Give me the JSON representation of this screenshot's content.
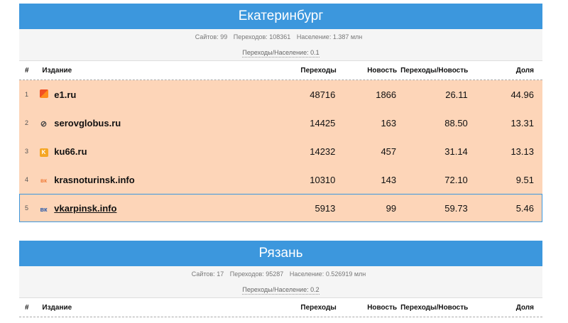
{
  "sections": [
    {
      "title": "Екатеринбург",
      "stats": {
        "sites_label": "Сайтов:",
        "sites_value": "99",
        "hits_label": "Переходов:",
        "hits_value": "108361",
        "population_label": "Население:",
        "population_value": "1.387 млн",
        "ratio_label": "Переходы/Население:",
        "ratio_value": "0.1"
      },
      "columns": {
        "num": "#",
        "name": "Издание",
        "hits": "Переходы",
        "news": "Новость",
        "ratio": "Переходы/Новость",
        "share": "Доля"
      },
      "rows": [
        {
          "num": "1",
          "icon": "e1-logo-icon",
          "name": "e1.ru",
          "hits": "48716",
          "news": "1866",
          "ratio": "26.11",
          "share": "44.96"
        },
        {
          "num": "2",
          "icon": "serovglobus-logo-icon",
          "name": "serovglobus.ru",
          "hits": "14425",
          "news": "163",
          "ratio": "88.50",
          "share": "13.31"
        },
        {
          "num": "3",
          "icon": "ku66-logo-icon",
          "name": "ku66.ru",
          "hits": "14232",
          "news": "457",
          "ratio": "31.14",
          "share": "13.13"
        },
        {
          "num": "4",
          "icon": "krasnoturinsk-logo-icon",
          "name": "krasnoturinsk.info",
          "hits": "10310",
          "news": "143",
          "ratio": "72.10",
          "share": "9.51"
        },
        {
          "num": "5",
          "icon": "vkarpinsk-logo-icon",
          "name": "vkarpinsk.info",
          "hits": "5913",
          "news": "99",
          "ratio": "59.73",
          "share": "5.46"
        }
      ]
    },
    {
      "title": "Рязань",
      "stats": {
        "sites_label": "Сайтов:",
        "sites_value": "17",
        "hits_label": "Переходов:",
        "hits_value": "95287",
        "population_label": "Население:",
        "population_value": "0.526919 млн",
        "ratio_label": "Переходы/Население:",
        "ratio_value": "0.2"
      },
      "columns": {
        "num": "#",
        "name": "Издание",
        "hits": "Переходы",
        "news": "Новость",
        "ratio": "Переходы/Новость",
        "share": "Доля"
      }
    }
  ]
}
